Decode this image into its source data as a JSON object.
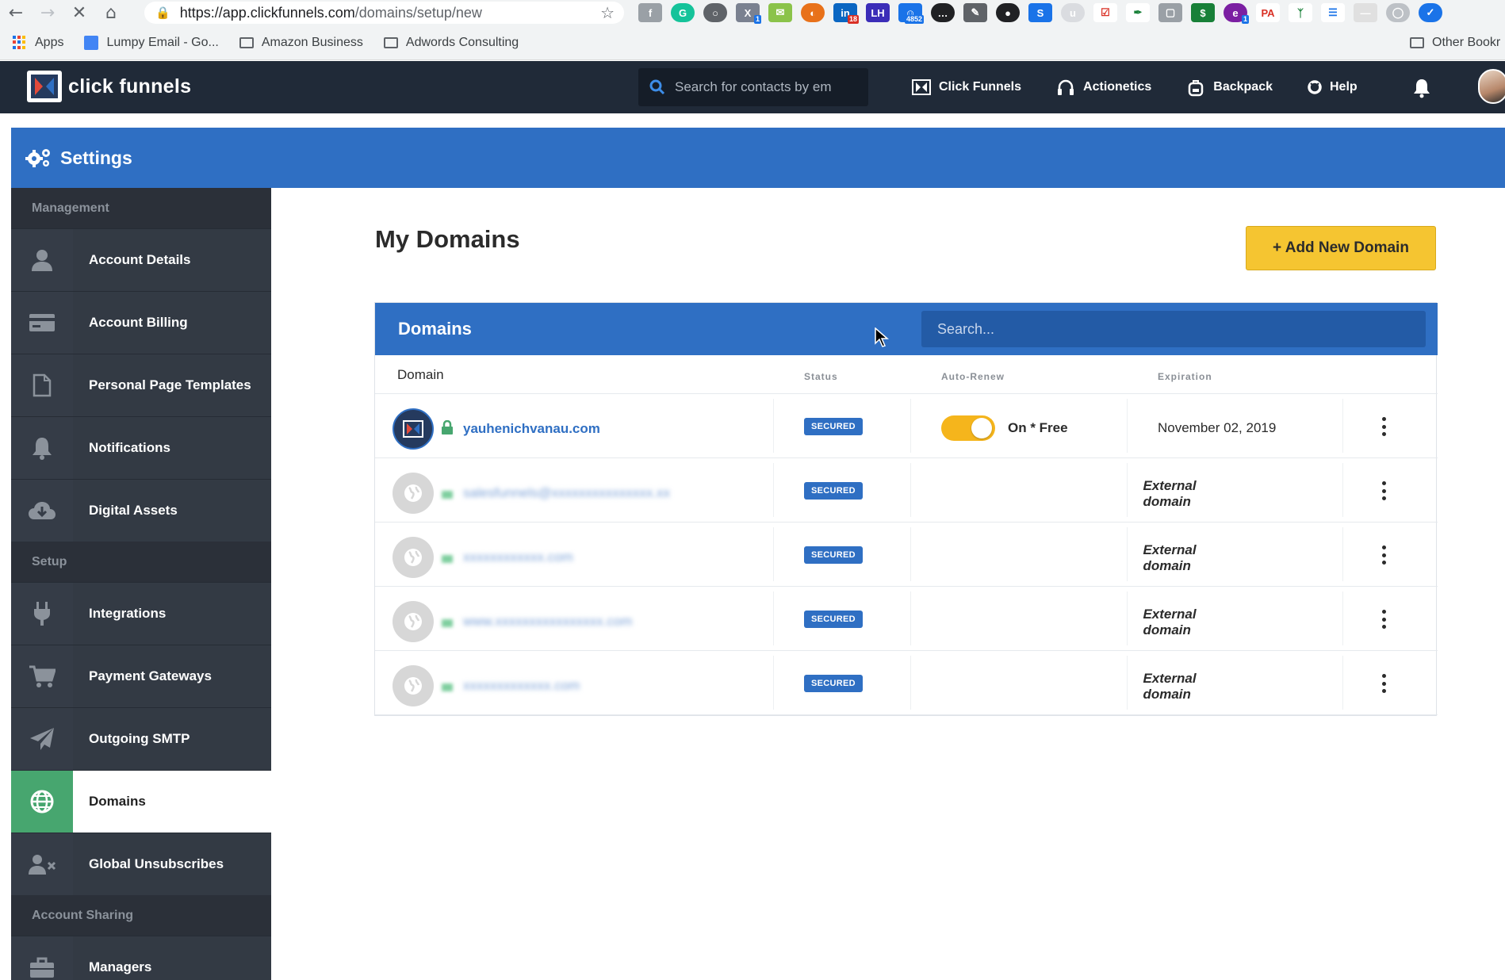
{
  "browser": {
    "url_host": "https://app.clickfunnels.com",
    "url_path": "/domains/setup/new",
    "extension_badges": [
      "1",
      "18",
      "LH",
      "4852",
      "1",
      "PA",
      "1"
    ],
    "bookmarks": [
      "Apps",
      "Lumpy Email - Go...",
      "Amazon Business",
      "Adwords Consulting"
    ],
    "other_bookmarks": "Other Bookr"
  },
  "header": {
    "logo_text": "click funnels",
    "search_placeholder": "Search for contacts by em",
    "nav": [
      "Click Funnels",
      "Actionetics",
      "Backpack",
      "Help"
    ]
  },
  "settings": {
    "title": "Settings"
  },
  "sidebar": {
    "sections": [
      {
        "title": "Management",
        "items": [
          {
            "label": "Account Details",
            "icon": "user-icon"
          },
          {
            "label": "Account Billing",
            "icon": "credit-card-icon"
          },
          {
            "label": "Personal Page Templates",
            "icon": "file-icon"
          },
          {
            "label": "Notifications",
            "icon": "bell-icon"
          },
          {
            "label": "Digital Assets",
            "icon": "cloud-download-icon"
          }
        ]
      },
      {
        "title": "Setup",
        "items": [
          {
            "label": "Integrations",
            "icon": "plug-icon"
          },
          {
            "label": "Payment Gateways",
            "icon": "cart-icon"
          },
          {
            "label": "Outgoing SMTP",
            "icon": "paper-plane-icon"
          },
          {
            "label": "Domains",
            "icon": "globe-icon",
            "active": true
          },
          {
            "label": "Global Unsubscribes",
            "icon": "user-times-icon"
          }
        ]
      },
      {
        "title": "Account Sharing",
        "items": [
          {
            "label": "Managers",
            "icon": "briefcase-icon"
          }
        ]
      }
    ]
  },
  "main": {
    "title": "My Domains",
    "add_button": "+ Add New Domain",
    "panel_title": "Domains",
    "search_placeholder": "Search...",
    "columns": {
      "domain": "Domain",
      "status": "Status",
      "auto_renew": "Auto-Renew",
      "expiration": "Expiration"
    },
    "rows": [
      {
        "domain": "yauhenichvanau.com",
        "status": "SECURED",
        "auto_renew_on": true,
        "auto_renew_label": "On * Free",
        "expiration": "November 02, 2019",
        "kind": "clickfunnels"
      },
      {
        "domain": "salesfunnels@xxxxxxxxxxxxxxx.xx",
        "status": "SECURED",
        "auto_renew_label": "",
        "expiration": "External domain",
        "kind": "external"
      },
      {
        "domain": "xxxxxxxxxxxx.com",
        "status": "SECURED",
        "auto_renew_label": "",
        "expiration": "External domain",
        "kind": "external"
      },
      {
        "domain": "www.xxxxxxxxxxxxxxxx.com",
        "status": "SECURED",
        "auto_renew_label": "",
        "expiration": "External domain",
        "kind": "external"
      },
      {
        "domain": "xxxxxxxxxxxxx.com",
        "status": "SECURED",
        "auto_renew_label": "",
        "expiration": "External domain",
        "kind": "external"
      }
    ]
  },
  "colors": {
    "brand_blue": "#2f6fc3",
    "header_dark": "#202a38",
    "sidebar_dark": "#2c333e",
    "active_green": "#47a66f",
    "cta_yellow": "#f5c531",
    "toggle_on": "#f5b51c"
  }
}
